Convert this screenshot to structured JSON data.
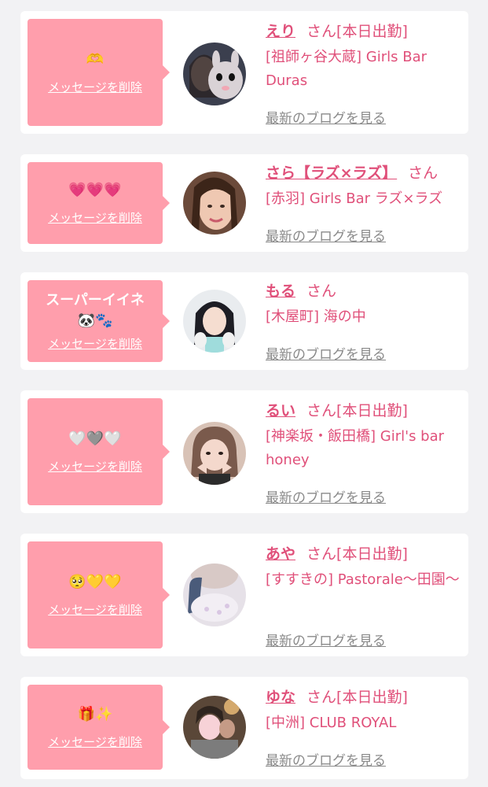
{
  "colors": {
    "accent_pink": "#e0507a",
    "bubble_pink": "#ff9eac",
    "background": "#f2f2f4",
    "card": "#ffffff",
    "link_gray": "#8a8a8a"
  },
  "common": {
    "delete_label": "メッセージを削除",
    "blog_label": "最新のブログを見る",
    "honorific": "さん"
  },
  "entries": [
    {
      "message": "🫶",
      "name": "えり",
      "status": "[本日出勤]",
      "shop": "[祖師ヶ谷大蔵] Girls Bar Duras"
    },
    {
      "message": "💗💗💗",
      "name": "さら【ラズ×ラズ】",
      "status": "",
      "shop": "[赤羽] Girls Bar ラズ×ラズ"
    },
    {
      "message": "スーパーイイネ🐼🐾",
      "name": "もる",
      "status": "",
      "shop": "[木屋町] 海の中"
    },
    {
      "message": "🤍🩶🤍",
      "name": "るい",
      "status": "[本日出勤]",
      "shop": "[神楽坂・飯田橋] Girl's bar honey"
    },
    {
      "message": "🥺💛💛",
      "name": "あや",
      "status": "[本日出勤]",
      "shop": "[すすきの] Pastorale〜田園〜"
    },
    {
      "message": "🎁✨",
      "name": "ゆな",
      "status": "[本日出勤]",
      "shop": "[中洲] CLUB ROYAL"
    }
  ]
}
